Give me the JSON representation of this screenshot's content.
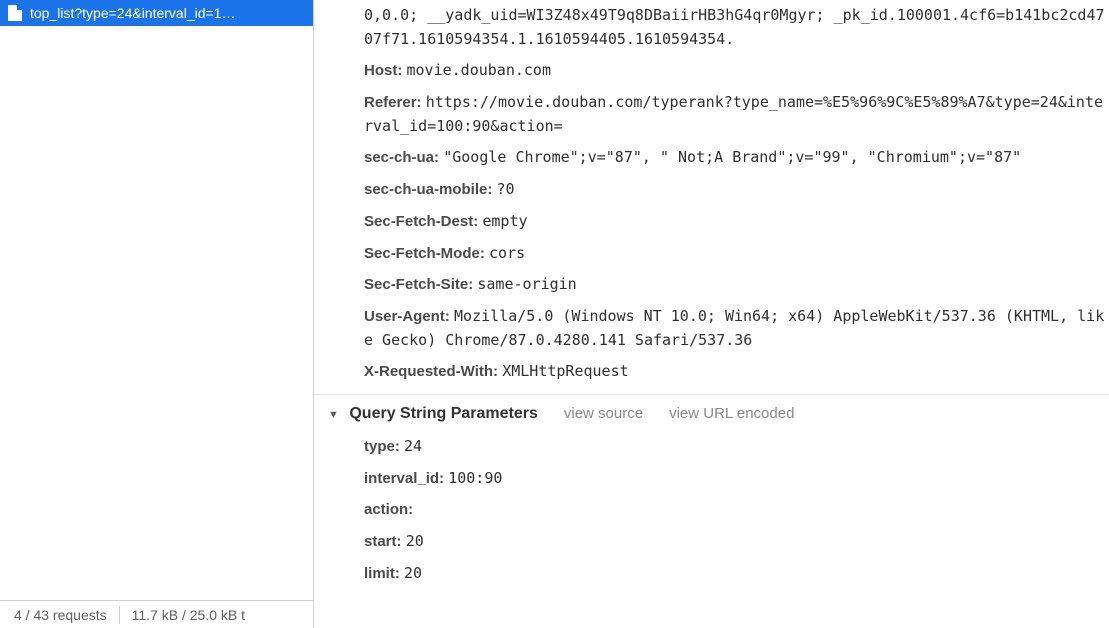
{
  "sidebar": {
    "items": [
      {
        "label": "top_list?type=24&interval_id=1…"
      }
    ],
    "status": {
      "requests": "4 / 43 requests",
      "transfer": "11.7 kB / 25.0 kB t"
    }
  },
  "headers": {
    "cookie_tail": "0,0.0; __yadk_uid=WI3Z48x49T9q8DBaiirHB3hG4qr0Mgyr; _pk_id.100001.4cf6=b141bc2cd4707f71.1610594354.1.1610594405.1610594354.",
    "items": [
      {
        "name": "Host",
        "value": "movie.douban.com"
      },
      {
        "name": "Referer",
        "value": "https://movie.douban.com/typerank?type_name=%E5%96%9C%E5%89%A7&type=24&interval_id=100:90&action="
      },
      {
        "name": "sec-ch-ua",
        "value": "\"Google Chrome\";v=\"87\", \" Not;A Brand\";v=\"99\", \"Chromium\";v=\"87\""
      },
      {
        "name": "sec-ch-ua-mobile",
        "value": "?0"
      },
      {
        "name": "Sec-Fetch-Dest",
        "value": "empty"
      },
      {
        "name": "Sec-Fetch-Mode",
        "value": "cors"
      },
      {
        "name": "Sec-Fetch-Site",
        "value": "same-origin"
      },
      {
        "name": "User-Agent",
        "value": "Mozilla/5.0 (Windows NT 10.0; Win64; x64) AppleWebKit/537.36 (KHTML, like Gecko) Chrome/87.0.4280.141 Safari/537.36"
      },
      {
        "name": "X-Requested-With",
        "value": "XMLHttpRequest"
      }
    ]
  },
  "query_section": {
    "title": "Query String Parameters",
    "view_source": "view source",
    "view_url_encoded": "view URL encoded",
    "params": [
      {
        "name": "type",
        "value": "24"
      },
      {
        "name": "interval_id",
        "value": "100:90"
      },
      {
        "name": "action",
        "value": ""
      },
      {
        "name": "start",
        "value": "20"
      },
      {
        "name": "limit",
        "value": "20"
      }
    ]
  }
}
